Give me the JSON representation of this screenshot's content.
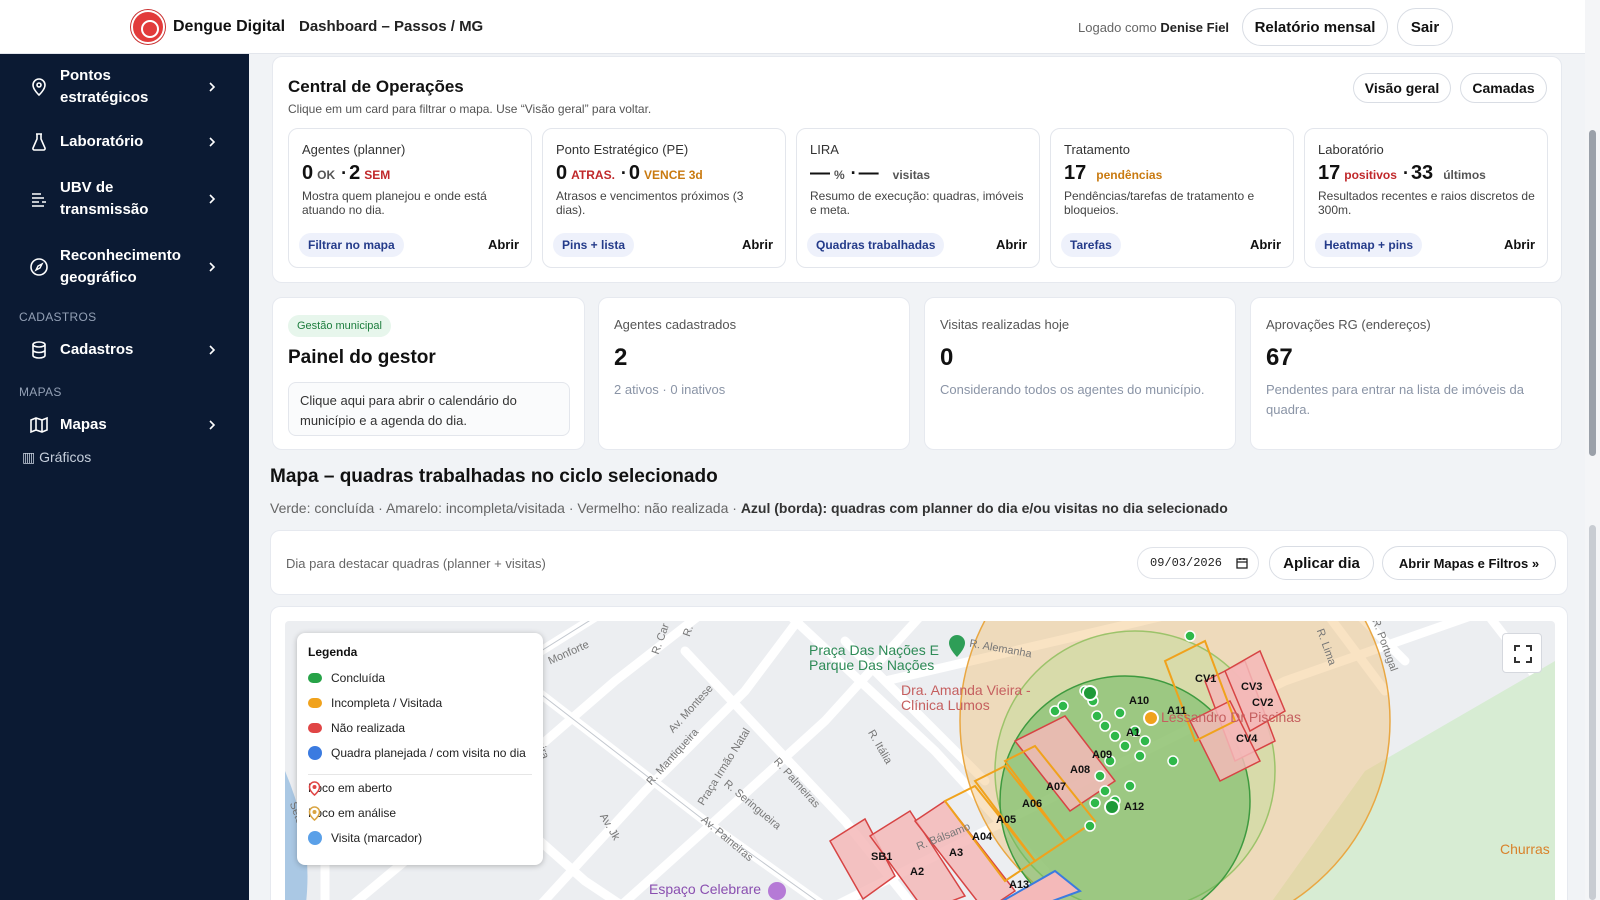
{
  "header": {
    "brand": "Dengue Digital",
    "title": "Dashboard – Passos / MG",
    "logged_prefix": "Logado como",
    "user": "Denise Fiel",
    "report_button": "Relatório mensal",
    "exit_button": "Sair"
  },
  "sidebar": {
    "items": [
      {
        "label": "Pontos estratégicos",
        "icon": "map-pin-icon"
      },
      {
        "label": "Laboratório",
        "icon": "flask-icon"
      },
      {
        "label": "UBV de transmissão",
        "icon": "spray-icon"
      },
      {
        "label": "Reconhecimento geográfico",
        "icon": "compass-icon"
      },
      {
        "label": "Cadastros",
        "icon": "database-icon"
      },
      {
        "label": "Mapas",
        "icon": "map-icon"
      }
    ],
    "sections": [
      "CADASTROS",
      "MAPAS"
    ],
    "cut_item": "Gráficos"
  },
  "operations": {
    "title": "Central de Operações",
    "subtitle": "Clique em um card para filtrar o mapa. Use “Visão geral” para voltar.",
    "overview_button": "Visão geral",
    "layers_button": "Camadas",
    "cards": [
      {
        "title": "Agentes (planner)",
        "m1": "0",
        "t1": "OK",
        "m2": "2",
        "t2": "SEM",
        "desc": "Mostra quem planejou e onde está atuando no dia.",
        "tag": "Filtrar no mapa",
        "open": "Abrir"
      },
      {
        "title": "Ponto Estratégico (PE)",
        "m1": "0",
        "t1": "ATRAS.",
        "m2": "0",
        "t2": "VENCE 3d",
        "desc": "Atrasos e vencimentos próximos (3 dias).",
        "tag": "Pins + lista",
        "open": "Abrir"
      },
      {
        "title": "LIRA",
        "m1": "—",
        "t1": "%",
        "m2": "—",
        "t2": "visitas",
        "desc": "Resumo de execução: quadras, imóveis e meta.",
        "tag": "Quadras trabalhadas",
        "open": "Abrir"
      },
      {
        "title": "Tratamento",
        "m1": "17",
        "t1": "pendências",
        "desc": "Pendências/tarefas de tratamento e bloqueios.",
        "tag": "Tarefas",
        "open": "Abrir"
      },
      {
        "title": "Laboratório",
        "m1": "17",
        "t1": "positivos",
        "m2": "33",
        "t2": "últimos",
        "desc": "Resultados recentes e raios discretos de 300m.",
        "tag": "Heatmap + pins",
        "open": "Abrir"
      }
    ]
  },
  "stats": {
    "gestor": {
      "badge": "Gestão municipal",
      "title": "Painel do gestor",
      "text": "Clique aqui para abrir o calendário do município e a agenda do dia."
    },
    "agents": {
      "label": "Agentes cadastrados",
      "value": "2",
      "note": "2 ativos · 0 inativos"
    },
    "visits": {
      "label": "Visitas realizadas hoje",
      "value": "0",
      "note": "Considerando todos os agentes do município."
    },
    "approvals": {
      "label": "Aprovações RG (endereços)",
      "value": "67",
      "note": "Pendentes para entrar na lista de imóveis da quadra."
    }
  },
  "map": {
    "title": "Mapa – quadras trabalhadas no ciclo selecionado",
    "legend_text": "Verde: concluída · Amarelo: incompleta/visitada · Vermelho: não realizada ·",
    "legend_bold": "Azul (borda): quadras com planner do dia e/ou visitas no dia selecionado",
    "filter_label": "Dia para destacar quadras (planner + visitas)",
    "date_value": "09/03/2026",
    "apply_button": "Aplicar dia",
    "maps_button": "Abrir Mapas e Filtros »",
    "legend": {
      "title": "Legenda",
      "items": [
        {
          "label": "Concluída",
          "color": "#27a348"
        },
        {
          "label": "Incompleta / Visitada",
          "color": "#f0a21c"
        },
        {
          "label": "Não realizada",
          "color": "#e04545"
        },
        {
          "label": "Quadra planejada / com visita no dia",
          "color": "#3b7be0"
        },
        {
          "label": "Foco em aberto",
          "color": "#e04545"
        },
        {
          "label": "Foco em análise",
          "color": "#d9a441"
        },
        {
          "label": "Visita (marcador)",
          "color": "#5aa0e8"
        }
      ]
    },
    "streets": [
      "Monforte",
      "R. Car",
      "R.",
      "Av. Montese",
      "R. Mantiqueira",
      "Praça Irmão Natal",
      "R. Seringueira",
      "R. Palmeiras",
      "Av. Paineiras",
      "Av. Jk",
      "R. Itália",
      "R. Alemanha",
      "R. Bálsamo",
      "R. Lima",
      "R. Portugal",
      "Sete",
      "heira"
    ],
    "pois": {
      "park": "Praça Das Nações E Parque Das Nações",
      "clinic": "Dra. Amanda Vieira - Clínica Lumos",
      "pools": "Lessandro Dr Piscinas",
      "event": "Espaço Celebrare",
      "churras": "Churras"
    },
    "blocks": [
      "A1",
      "A2",
      "A3",
      "A04",
      "A05",
      "A06",
      "A07",
      "A08",
      "A09",
      "A10",
      "A11",
      "A12",
      "A13",
      "SB1",
      "CV1",
      "CV2",
      "CV3",
      "CV4"
    ]
  }
}
